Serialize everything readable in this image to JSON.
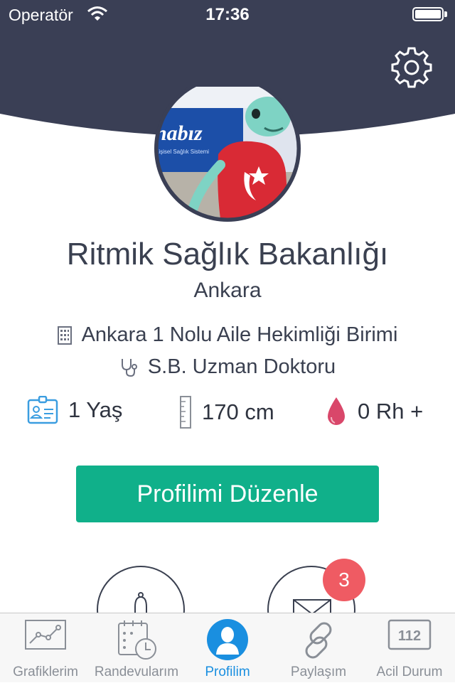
{
  "status_bar": {
    "carrier": "Operatör",
    "time": "17:36"
  },
  "profile": {
    "name": "Ritmik Sağlık Bakanlığı",
    "city": "Ankara",
    "unit": "Ankara 1 Nolu Aile Hekimliği Birimi",
    "doctor": "S.B. Uzman Doktoru",
    "avatar_text": "nabız",
    "avatar_subtext": "Kişisel Sağlık Sistemi"
  },
  "stats": {
    "age": "1 Yaş",
    "height": "170 cm",
    "blood": "0 Rh +"
  },
  "edit_button": "Profilimi Düzenle",
  "messages_badge": "3",
  "tabs": [
    {
      "label": "Grafiklerim",
      "icon": "chart-icon"
    },
    {
      "label": "Randevularım",
      "icon": "calendar-clock-icon"
    },
    {
      "label": "Profilim",
      "icon": "profile-icon"
    },
    {
      "label": "Paylaşım",
      "icon": "link-icon"
    },
    {
      "label": "Acil Durum",
      "icon": "emergency-112-icon"
    }
  ],
  "emergency_number": "112",
  "colors": {
    "header": "#3a3f55",
    "accent": "#10b08a",
    "badge": "#ef5b63",
    "active_tab": "#1a8fe0",
    "text": "#3a4050"
  }
}
